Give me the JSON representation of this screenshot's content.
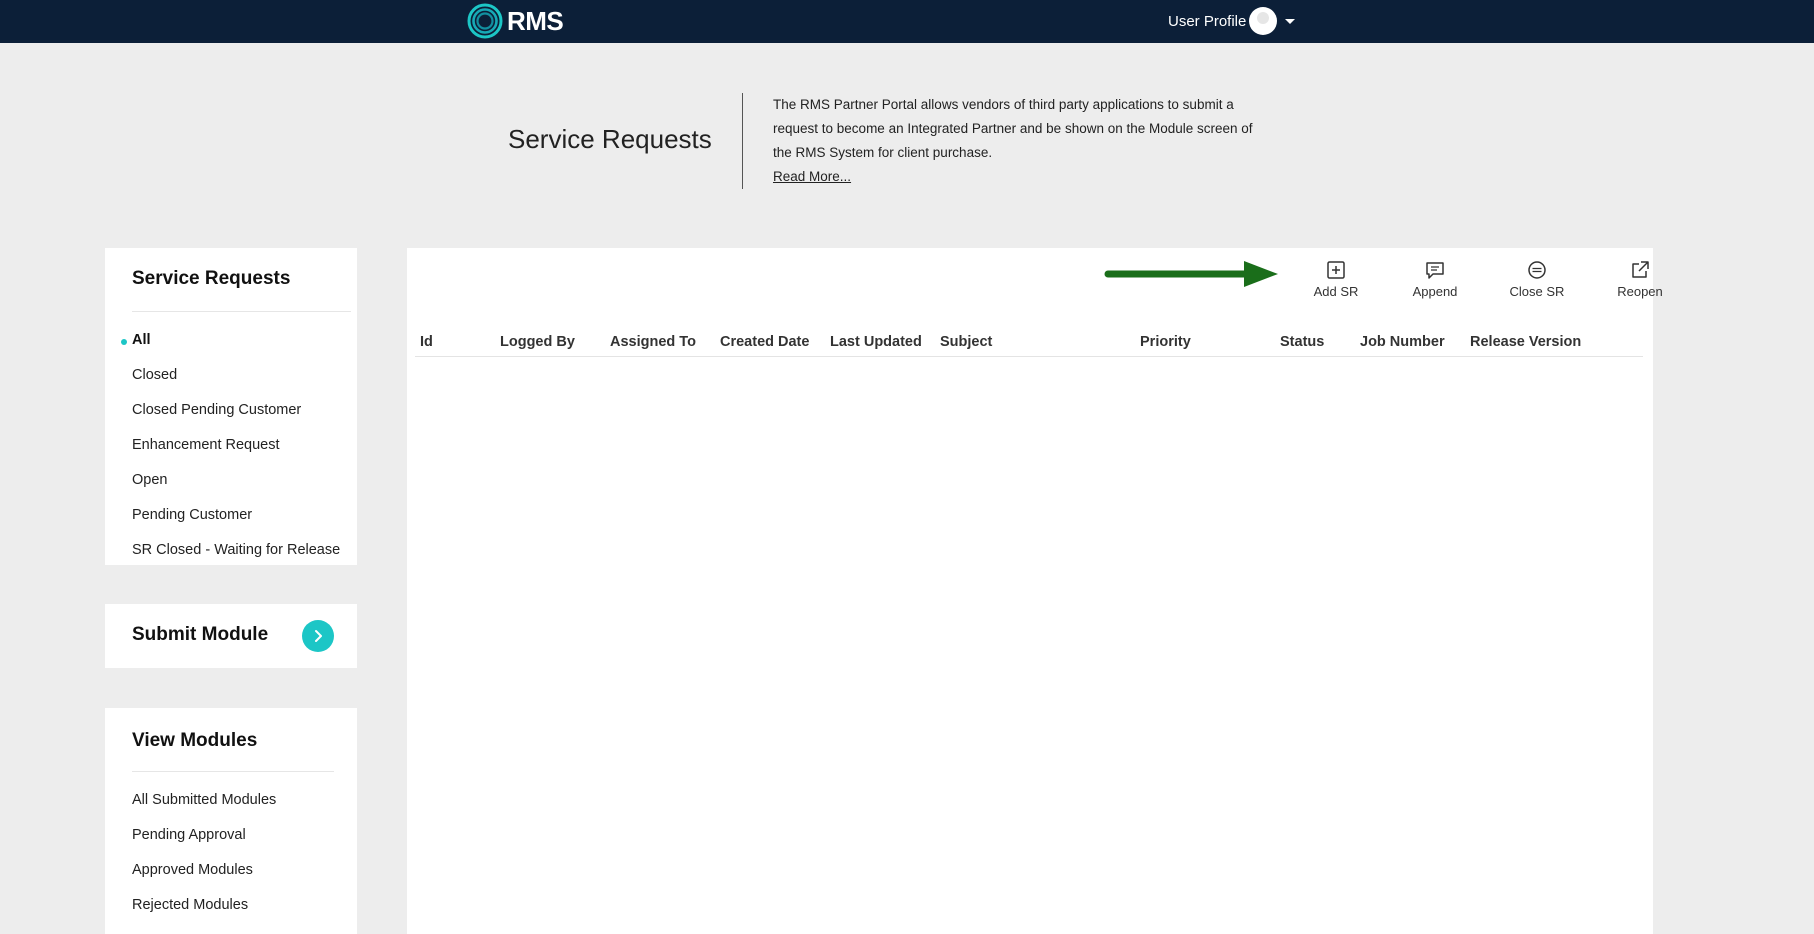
{
  "topbar": {
    "logo_text": "RMS",
    "profile_label": "User Profile"
  },
  "header": {
    "title": "Service Requests",
    "intro": "The RMS Partner Portal allows vendors of third party applications to submit a request to become an Integrated Partner and be shown on the Module screen of the RMS System for client purchase.",
    "read_more": "Read More..."
  },
  "sidebar": {
    "service_requests": {
      "title": "Service Requests",
      "items": [
        {
          "label": "All",
          "active": true
        },
        {
          "label": "Closed"
        },
        {
          "label": "Closed Pending Customer"
        },
        {
          "label": "Enhancement Request"
        },
        {
          "label": "Open"
        },
        {
          "label": "Pending Customer"
        },
        {
          "label": "SR Closed - Waiting for Release"
        }
      ]
    },
    "submit_module": {
      "title": "Submit Module",
      "icon": "chevron-right-icon"
    },
    "view_modules": {
      "title": "View Modules",
      "items": [
        {
          "label": "All Submitted Modules"
        },
        {
          "label": "Pending Approval"
        },
        {
          "label": "Approved Modules"
        },
        {
          "label": "Rejected Modules"
        }
      ]
    }
  },
  "toolbar": {
    "add_sr": {
      "label": "Add SR",
      "icon": "plus-square-icon"
    },
    "append": {
      "label": "Append",
      "icon": "comment-icon"
    },
    "close_sr": {
      "label": "Close SR",
      "icon": "circle-minus-icon"
    },
    "reopen": {
      "label": "Reopen",
      "icon": "external-link-icon"
    }
  },
  "table": {
    "columns": [
      "Id",
      "Logged By",
      "Assigned To",
      "Created Date",
      "Last Updated",
      "Subject",
      "Priority",
      "Status",
      "Job Number",
      "Release Version"
    ],
    "rows": []
  },
  "colors": {
    "topbar": "#0c1f38",
    "accent": "#1cc6c6",
    "annotation_arrow": "#1a6e1a",
    "page_bg": "#ededed"
  }
}
